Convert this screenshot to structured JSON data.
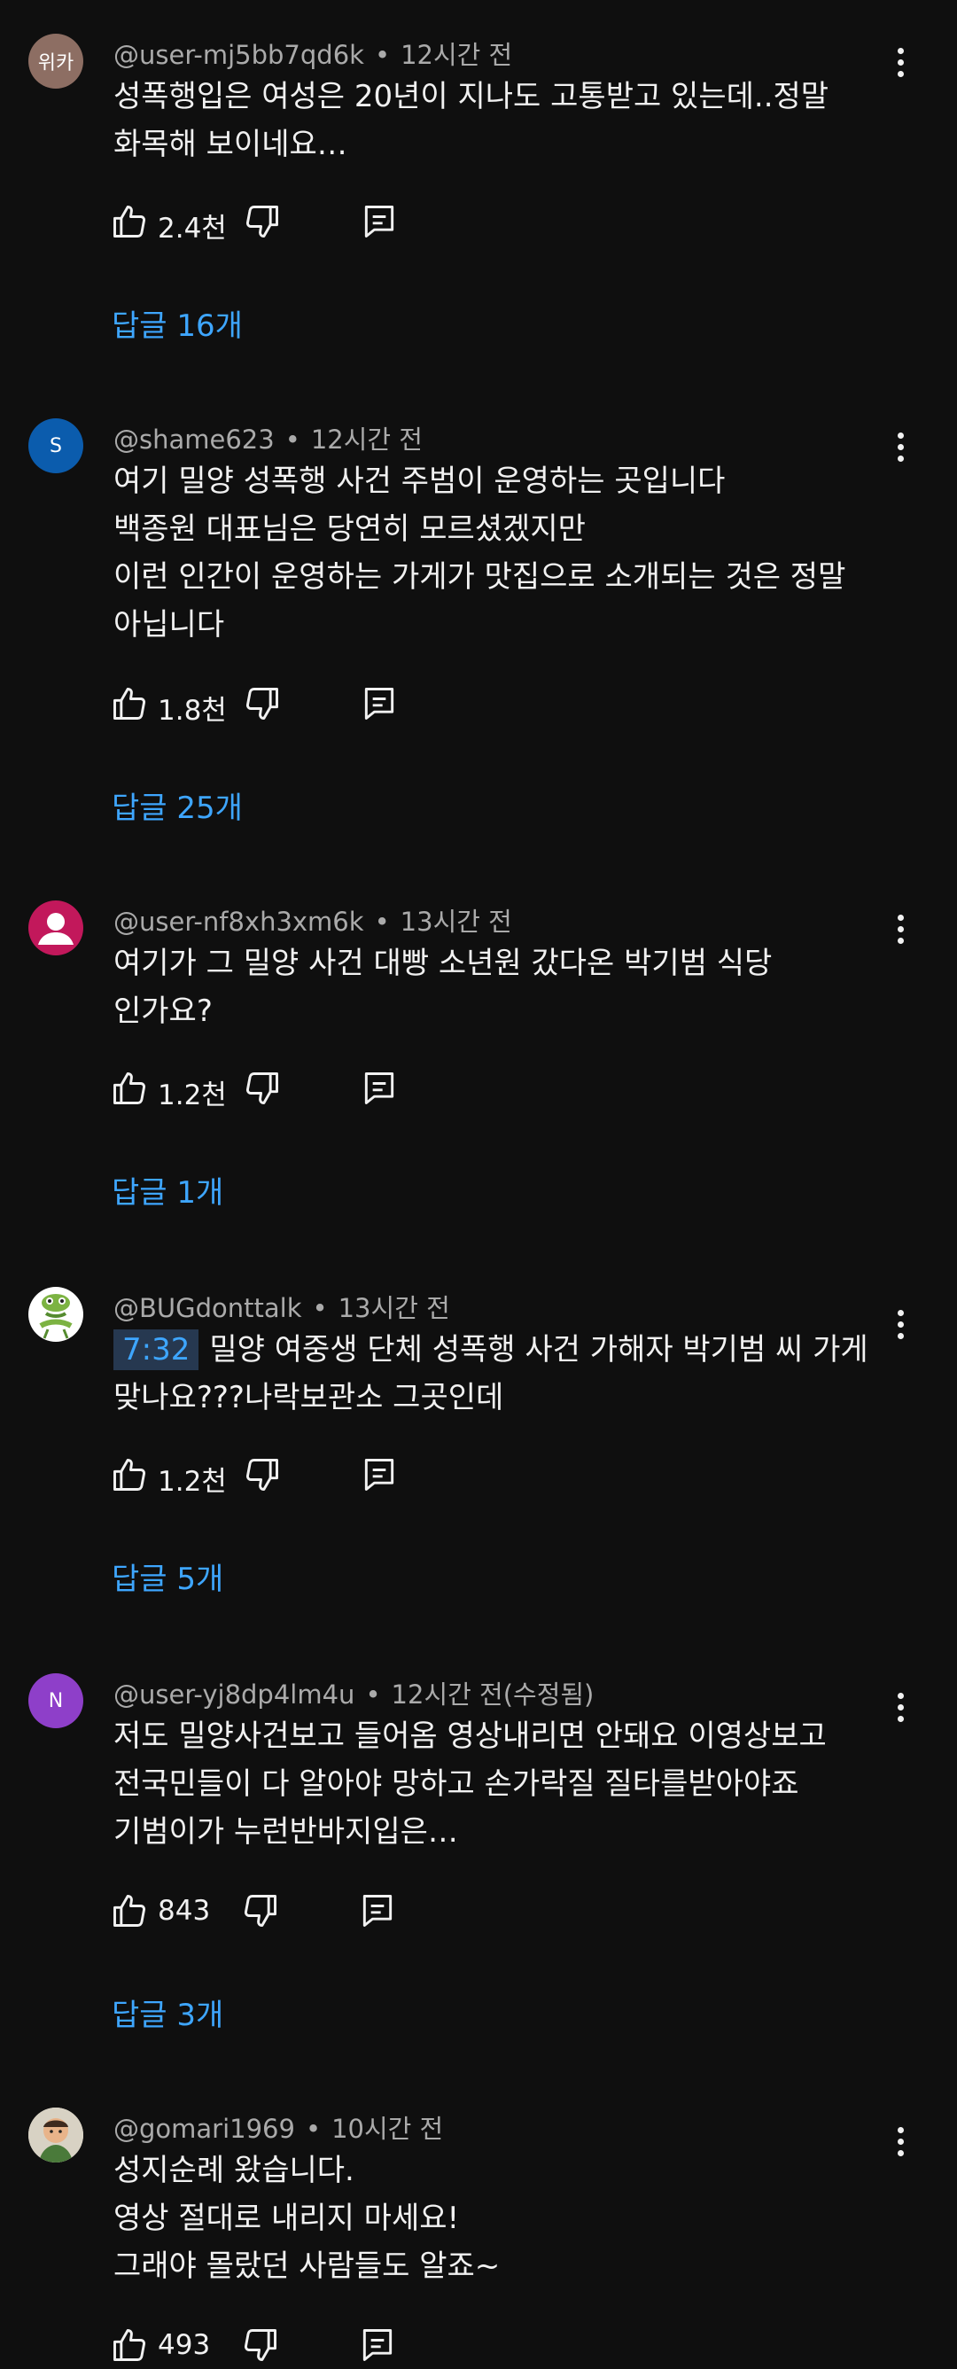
{
  "comments": [
    {
      "handle": "@user-mj5bb7qd6k",
      "time": "12시간 전",
      "avatar": {
        "text": "위카",
        "bg": "#8d6e63"
      },
      "lines": [
        "성폭행입은 여성은 20년이 지나도 고통받고 있는데..정말",
        "화목해 보이네요…"
      ],
      "likes": "2.4천",
      "replies": "답글 16개"
    },
    {
      "handle": "@shame623",
      "time": "12시간 전",
      "avatar": {
        "text": "S",
        "bg": "#0b5cad"
      },
      "lines": [
        "여기 밀양 성폭행 사건 주범이 운영하는 곳입니다",
        "백종원 대표님은 당연히 모르셨겠지만",
        "이런 인간이 운영하는 가게가 맛집으로 소개되는 것은 정말",
        "아닙니다"
      ],
      "likes": "1.8천",
      "replies": "답글 25개"
    },
    {
      "handle": "@user-nf8xh3xm6k",
      "time": "13시간 전",
      "avatar": {
        "text": "",
        "bg": "#c2185b"
      },
      "lines": [
        "여기가 그 밀양 사건 대빵 소년원 갔다온 박기범 식당",
        "인가요?"
      ],
      "likes": "1.2천",
      "replies": "답글 1개"
    },
    {
      "handle": "@BUGdonttalk",
      "time": "13시간 전",
      "avatar": {
        "text": "",
        "bg": "#ffffff"
      },
      "timestamp": "7:32",
      "lines": [
        "밀양 여중생 단체 성폭행 사건 가해자 박기범 씨 가게",
        "맞나요???나락보관소 그곳인데"
      ],
      "likes": "1.2천",
      "replies": "답글 5개"
    },
    {
      "handle": "@user-yj8dp4lm4u",
      "time": "12시간 전(수정됨)",
      "avatar": {
        "text": "N",
        "bg": "#8e3fc9"
      },
      "lines": [
        "저도 밀양사건보고  들어옴 영상내리면 안돼요 이영상보고",
        "전국민들이 다 알아야 망하고 손가락질 질타를받아야죠",
        "기범이가 누런반바지입은…"
      ],
      "likes": "843",
      "replies": "답글 3개"
    },
    {
      "handle": "@gomari1969",
      "time": "10시간 전",
      "avatar": {
        "text": "",
        "bg": "#d8d2c4"
      },
      "lines": [
        "성지순례 왔습니다.",
        "영상 절대로 내리지 마세요!",
        "그래야 몰랐던 사람들도 알죠~"
      ],
      "likes": "493",
      "replies": ""
    }
  ],
  "icons": {
    "like": "thumbs-up-icon",
    "dislike": "thumbs-down-icon",
    "reply": "reply-comment-icon",
    "more": "more-vertical-icon"
  },
  "colors": {
    "background": "#0f0f0f",
    "link": "#3ea6ff",
    "meta": "#aaaaaa",
    "text": "#f1f1f1"
  }
}
